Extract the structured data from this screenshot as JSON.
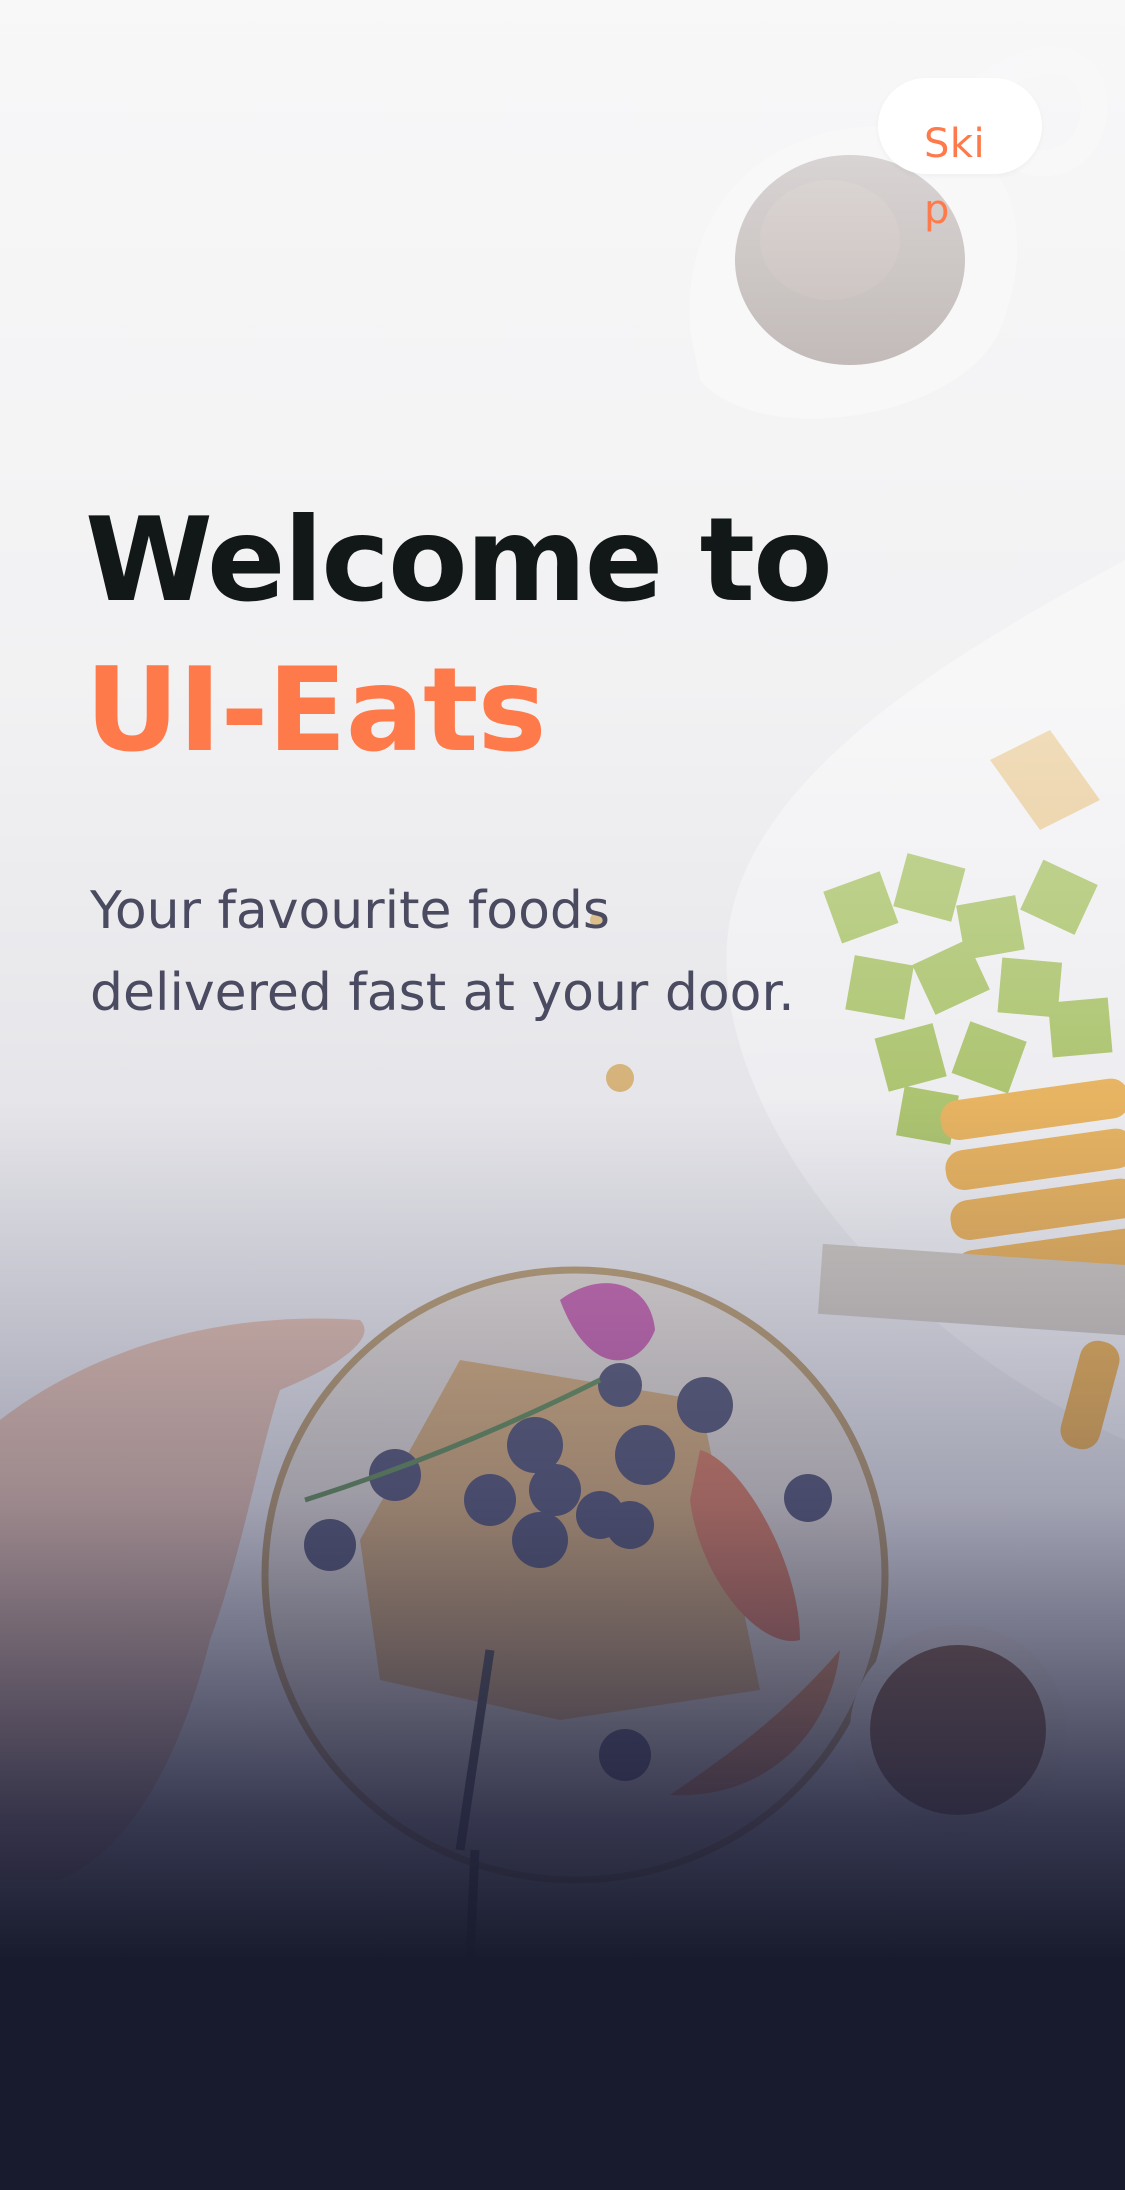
{
  "skip_button": {
    "label": "Skip"
  },
  "headline": {
    "line1": "Welcome to",
    "line2": "UI-Eats"
  },
  "subtitle": {
    "line1": "Your favourite foods",
    "line2": "delivered fast at your door."
  },
  "colors": {
    "accent": "#ff7a4a",
    "headline": "#121717",
    "subtitle": "#4a4b60",
    "bottom_fade": "#181a2d"
  }
}
